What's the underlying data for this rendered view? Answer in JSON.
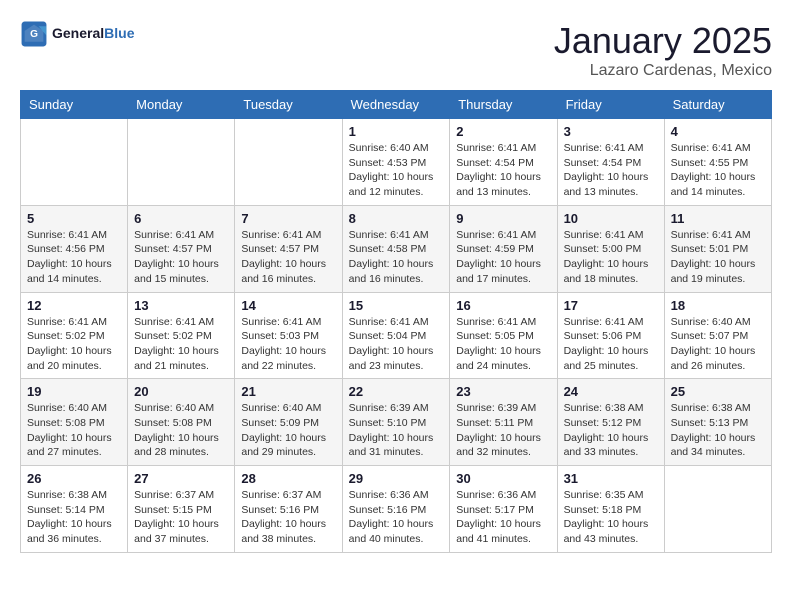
{
  "header": {
    "logo_general": "General",
    "logo_blue": "Blue",
    "title": "January 2025",
    "subtitle": "Lazaro Cardenas, Mexico"
  },
  "weekdays": [
    "Sunday",
    "Monday",
    "Tuesday",
    "Wednesday",
    "Thursday",
    "Friday",
    "Saturday"
  ],
  "weeks": [
    [
      {
        "day": "",
        "info": ""
      },
      {
        "day": "",
        "info": ""
      },
      {
        "day": "",
        "info": ""
      },
      {
        "day": "1",
        "info": "Sunrise: 6:40 AM\nSunset: 4:53 PM\nDaylight: 10 hours\nand 12 minutes."
      },
      {
        "day": "2",
        "info": "Sunrise: 6:41 AM\nSunset: 4:54 PM\nDaylight: 10 hours\nand 13 minutes."
      },
      {
        "day": "3",
        "info": "Sunrise: 6:41 AM\nSunset: 4:54 PM\nDaylight: 10 hours\nand 13 minutes."
      },
      {
        "day": "4",
        "info": "Sunrise: 6:41 AM\nSunset: 4:55 PM\nDaylight: 10 hours\nand 14 minutes."
      }
    ],
    [
      {
        "day": "5",
        "info": "Sunrise: 6:41 AM\nSunset: 4:56 PM\nDaylight: 10 hours\nand 14 minutes."
      },
      {
        "day": "6",
        "info": "Sunrise: 6:41 AM\nSunset: 4:57 PM\nDaylight: 10 hours\nand 15 minutes."
      },
      {
        "day": "7",
        "info": "Sunrise: 6:41 AM\nSunset: 4:57 PM\nDaylight: 10 hours\nand 16 minutes."
      },
      {
        "day": "8",
        "info": "Sunrise: 6:41 AM\nSunset: 4:58 PM\nDaylight: 10 hours\nand 16 minutes."
      },
      {
        "day": "9",
        "info": "Sunrise: 6:41 AM\nSunset: 4:59 PM\nDaylight: 10 hours\nand 17 minutes."
      },
      {
        "day": "10",
        "info": "Sunrise: 6:41 AM\nSunset: 5:00 PM\nDaylight: 10 hours\nand 18 minutes."
      },
      {
        "day": "11",
        "info": "Sunrise: 6:41 AM\nSunset: 5:01 PM\nDaylight: 10 hours\nand 19 minutes."
      }
    ],
    [
      {
        "day": "12",
        "info": "Sunrise: 6:41 AM\nSunset: 5:02 PM\nDaylight: 10 hours\nand 20 minutes."
      },
      {
        "day": "13",
        "info": "Sunrise: 6:41 AM\nSunset: 5:02 PM\nDaylight: 10 hours\nand 21 minutes."
      },
      {
        "day": "14",
        "info": "Sunrise: 6:41 AM\nSunset: 5:03 PM\nDaylight: 10 hours\nand 22 minutes."
      },
      {
        "day": "15",
        "info": "Sunrise: 6:41 AM\nSunset: 5:04 PM\nDaylight: 10 hours\nand 23 minutes."
      },
      {
        "day": "16",
        "info": "Sunrise: 6:41 AM\nSunset: 5:05 PM\nDaylight: 10 hours\nand 24 minutes."
      },
      {
        "day": "17",
        "info": "Sunrise: 6:41 AM\nSunset: 5:06 PM\nDaylight: 10 hours\nand 25 minutes."
      },
      {
        "day": "18",
        "info": "Sunrise: 6:40 AM\nSunset: 5:07 PM\nDaylight: 10 hours\nand 26 minutes."
      }
    ],
    [
      {
        "day": "19",
        "info": "Sunrise: 6:40 AM\nSunset: 5:08 PM\nDaylight: 10 hours\nand 27 minutes."
      },
      {
        "day": "20",
        "info": "Sunrise: 6:40 AM\nSunset: 5:08 PM\nDaylight: 10 hours\nand 28 minutes."
      },
      {
        "day": "21",
        "info": "Sunrise: 6:40 AM\nSunset: 5:09 PM\nDaylight: 10 hours\nand 29 minutes."
      },
      {
        "day": "22",
        "info": "Sunrise: 6:39 AM\nSunset: 5:10 PM\nDaylight: 10 hours\nand 31 minutes."
      },
      {
        "day": "23",
        "info": "Sunrise: 6:39 AM\nSunset: 5:11 PM\nDaylight: 10 hours\nand 32 minutes."
      },
      {
        "day": "24",
        "info": "Sunrise: 6:38 AM\nSunset: 5:12 PM\nDaylight: 10 hours\nand 33 minutes."
      },
      {
        "day": "25",
        "info": "Sunrise: 6:38 AM\nSunset: 5:13 PM\nDaylight: 10 hours\nand 34 minutes."
      }
    ],
    [
      {
        "day": "26",
        "info": "Sunrise: 6:38 AM\nSunset: 5:14 PM\nDaylight: 10 hours\nand 36 minutes."
      },
      {
        "day": "27",
        "info": "Sunrise: 6:37 AM\nSunset: 5:15 PM\nDaylight: 10 hours\nand 37 minutes."
      },
      {
        "day": "28",
        "info": "Sunrise: 6:37 AM\nSunset: 5:16 PM\nDaylight: 10 hours\nand 38 minutes."
      },
      {
        "day": "29",
        "info": "Sunrise: 6:36 AM\nSunset: 5:16 PM\nDaylight: 10 hours\nand 40 minutes."
      },
      {
        "day": "30",
        "info": "Sunrise: 6:36 AM\nSunset: 5:17 PM\nDaylight: 10 hours\nand 41 minutes."
      },
      {
        "day": "31",
        "info": "Sunrise: 6:35 AM\nSunset: 5:18 PM\nDaylight: 10 hours\nand 43 minutes."
      },
      {
        "day": "",
        "info": ""
      }
    ]
  ]
}
